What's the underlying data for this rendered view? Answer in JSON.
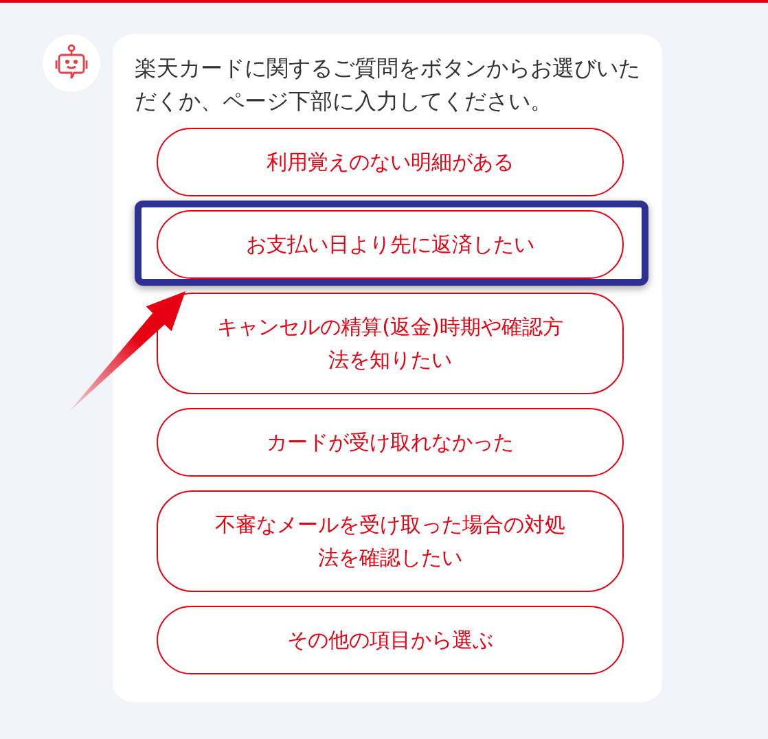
{
  "message": {
    "text": "楽天カードに関するご質問をボタンからお選びいただくか、ページ下部に入力してください。"
  },
  "options": [
    {
      "label": "利用覚えのない明細がある",
      "highlighted": false
    },
    {
      "label": "お支払い日より先に返済したい",
      "highlighted": true
    },
    {
      "label": "キャンセルの精算(返金)時期や確認方法を知りたい",
      "highlighted": false
    },
    {
      "label": "カードが受け取れなかった",
      "highlighted": false
    },
    {
      "label": "不審なメールを受け取った場合の対処法を確認したい",
      "highlighted": false
    },
    {
      "label": "その他の項目から選ぶ",
      "highlighted": false
    }
  ]
}
